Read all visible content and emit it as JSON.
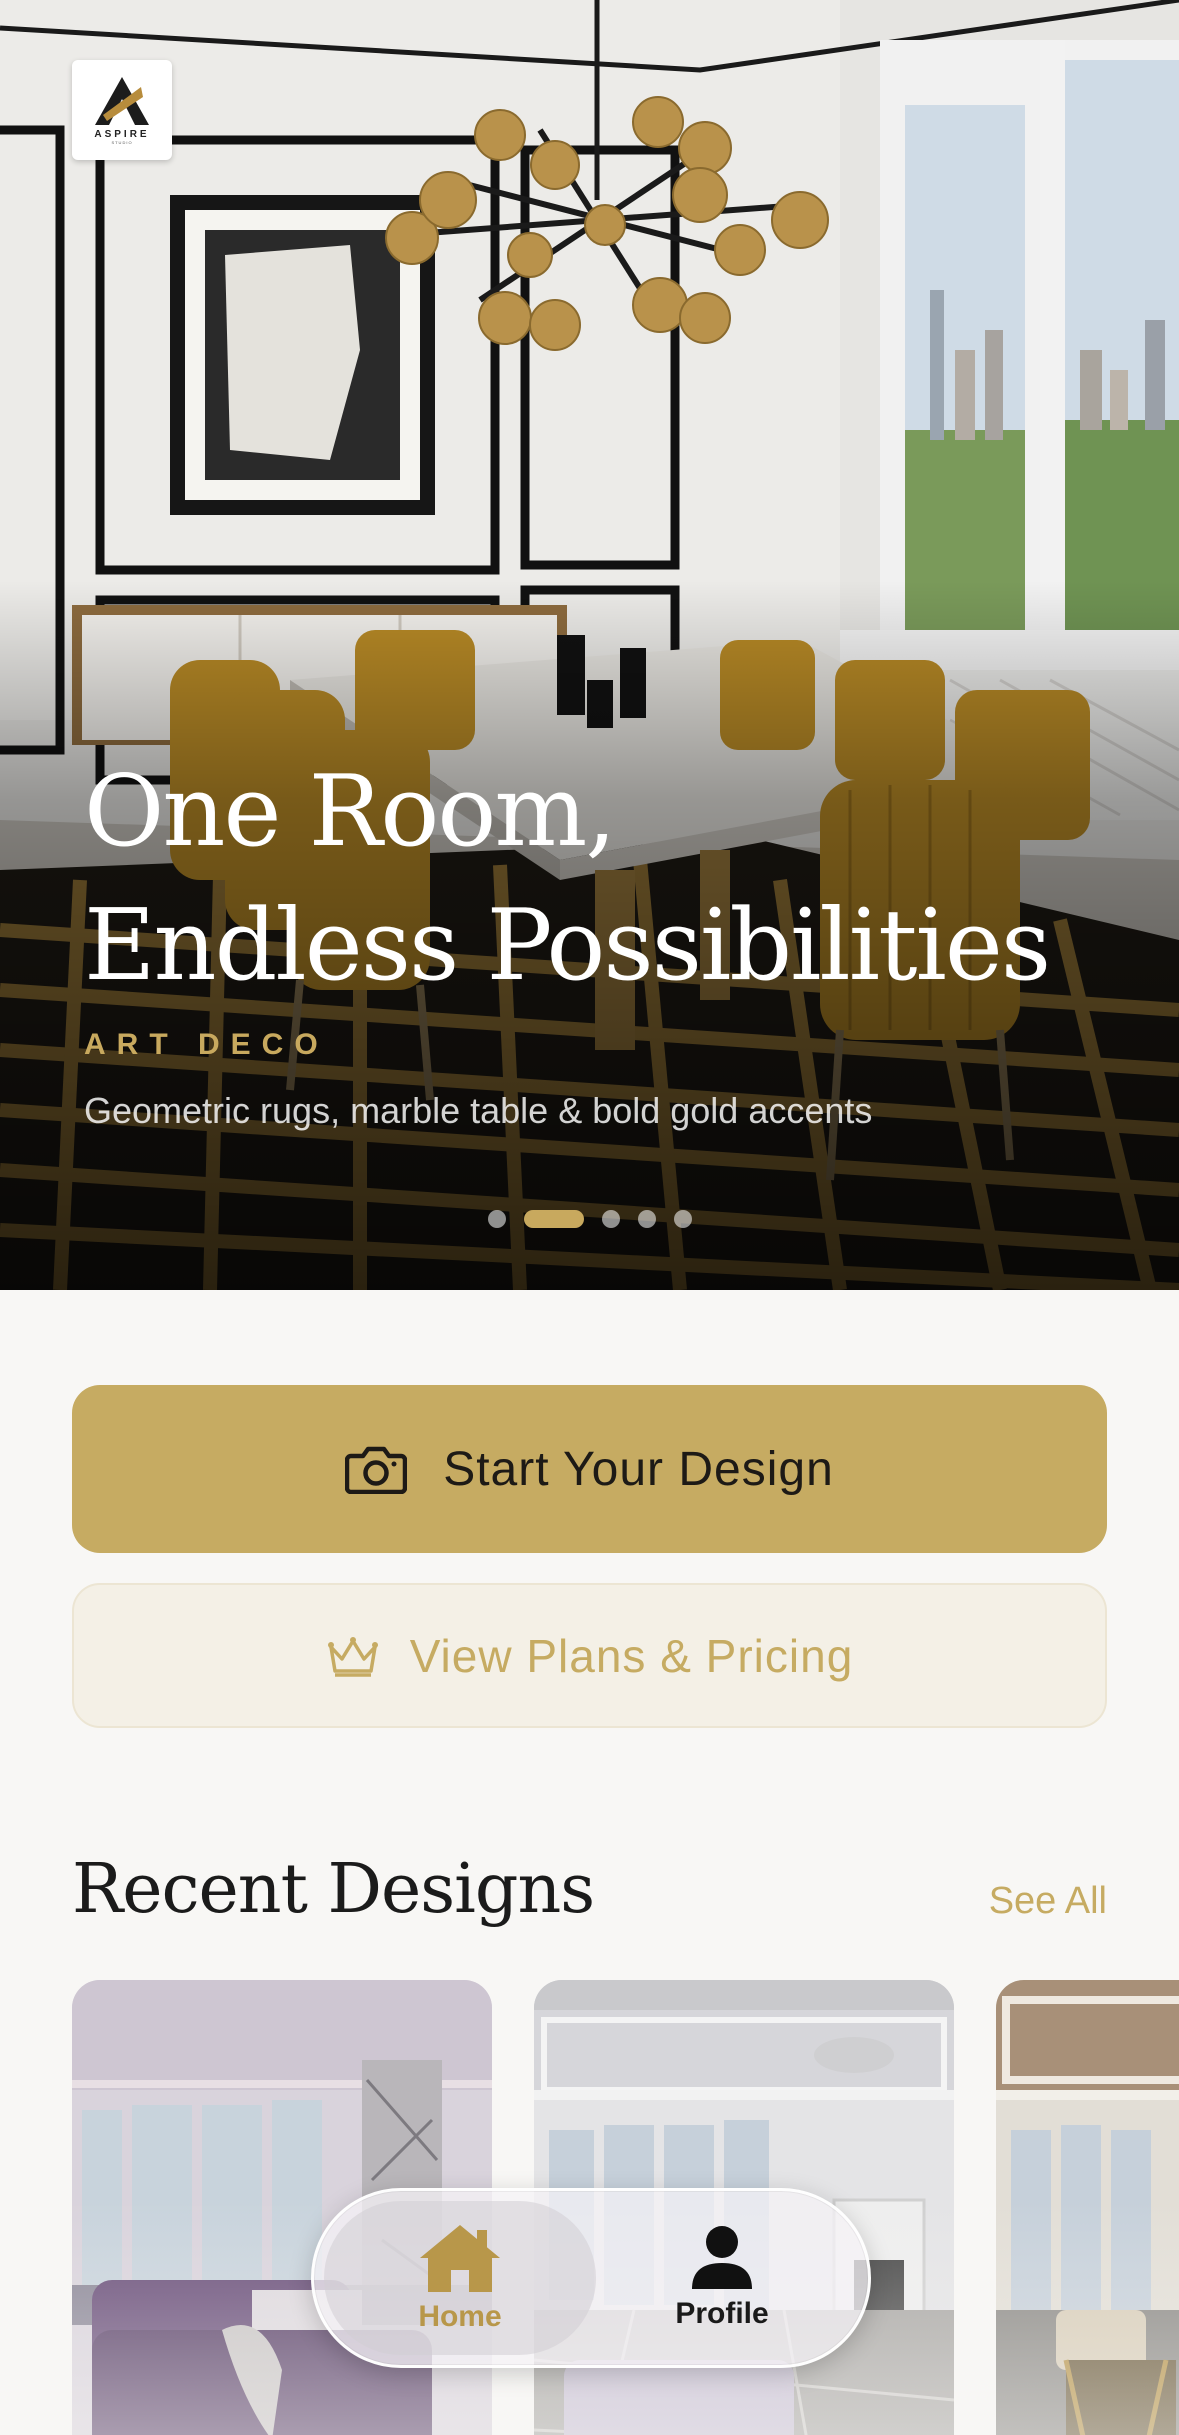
{
  "brand": {
    "logo_text": "ASPIRE",
    "logo_subtext": "STUDIO"
  },
  "hero": {
    "title_line1": "One Room,",
    "title_line2": "Endless Possibilities",
    "style_tag": "ART DECO",
    "subtitle": "Geometric rugs, marble table & bold gold accents",
    "carousel": {
      "total": 5,
      "active_index": 1
    }
  },
  "actions": {
    "primary_label": "Start Your Design",
    "primary_icon": "camera-icon",
    "secondary_label": "View Plans & Pricing",
    "secondary_icon": "crown-icon"
  },
  "recent": {
    "title": "Recent Designs",
    "see_all": "See All",
    "cards": [
      {
        "style": "purple-lounge"
      },
      {
        "style": "white-classic"
      },
      {
        "style": "gold-parisian"
      }
    ]
  },
  "tabbar": {
    "items": [
      {
        "label": "Home",
        "icon": "home-icon",
        "active": true
      },
      {
        "label": "Profile",
        "icon": "person-icon",
        "active": false
      }
    ]
  },
  "colors": {
    "accent_gold": "#C6AB62",
    "background": "#F8F7F5",
    "secondary_bg": "#F4F0E6"
  }
}
